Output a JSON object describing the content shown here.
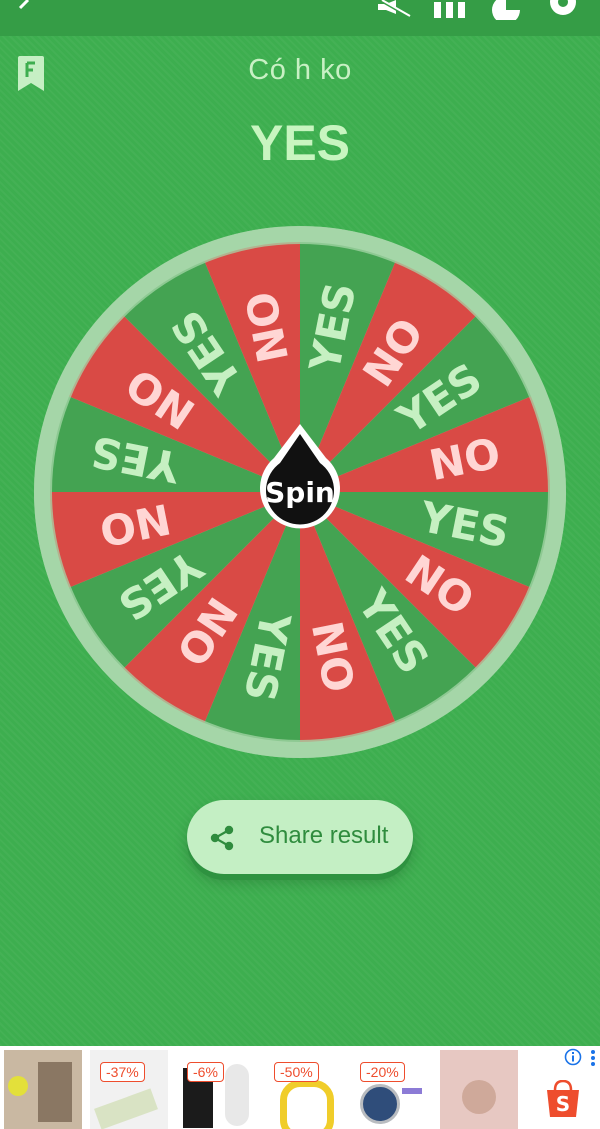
{
  "status_bar": {
    "icons": [
      "back-arrow-icon",
      "mute-icon",
      "columns-icon",
      "pie-chart-icon",
      "settings-icon"
    ]
  },
  "wheel": {
    "title": "Có h ko",
    "result": "YES",
    "spin_label": "Spin",
    "segments": [
      "YES",
      "NO",
      "YES",
      "NO",
      "YES",
      "NO",
      "YES",
      "NO",
      "YES",
      "NO",
      "YES",
      "NO",
      "YES",
      "NO",
      "YES",
      "NO"
    ],
    "colors": {
      "yes": "#44a352",
      "no": "#d94a45",
      "yes_text": "#c6f0c2",
      "no_text": "#ffd6d4",
      "rim": "#a5d6a8"
    }
  },
  "share": {
    "label": "Share result",
    "icon": "share-icon"
  },
  "ads": {
    "discounts": [
      "-37%",
      "-6%",
      "-50%",
      "-20%"
    ],
    "icons": [
      "info-icon",
      "more-vert-icon",
      "shopee-bag-icon"
    ],
    "shop_letter": "S"
  },
  "colors": {
    "background": "#3dae4f",
    "button_bg": "#c4efc4",
    "button_text": "#2f8c3e",
    "sale": "#ee4d2d"
  }
}
